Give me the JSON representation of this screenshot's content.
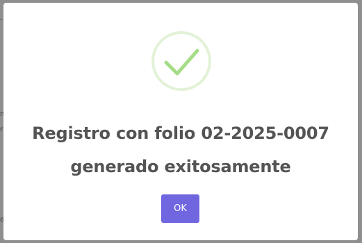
{
  "dialog": {
    "title_line1": "Registro con folio 02-2025-0007",
    "title_line2": "generado exitosamente",
    "confirm_label": "OK",
    "icon": "success-check-icon",
    "accent_color": "#a5dc86",
    "button_color": "#7066e0"
  }
}
